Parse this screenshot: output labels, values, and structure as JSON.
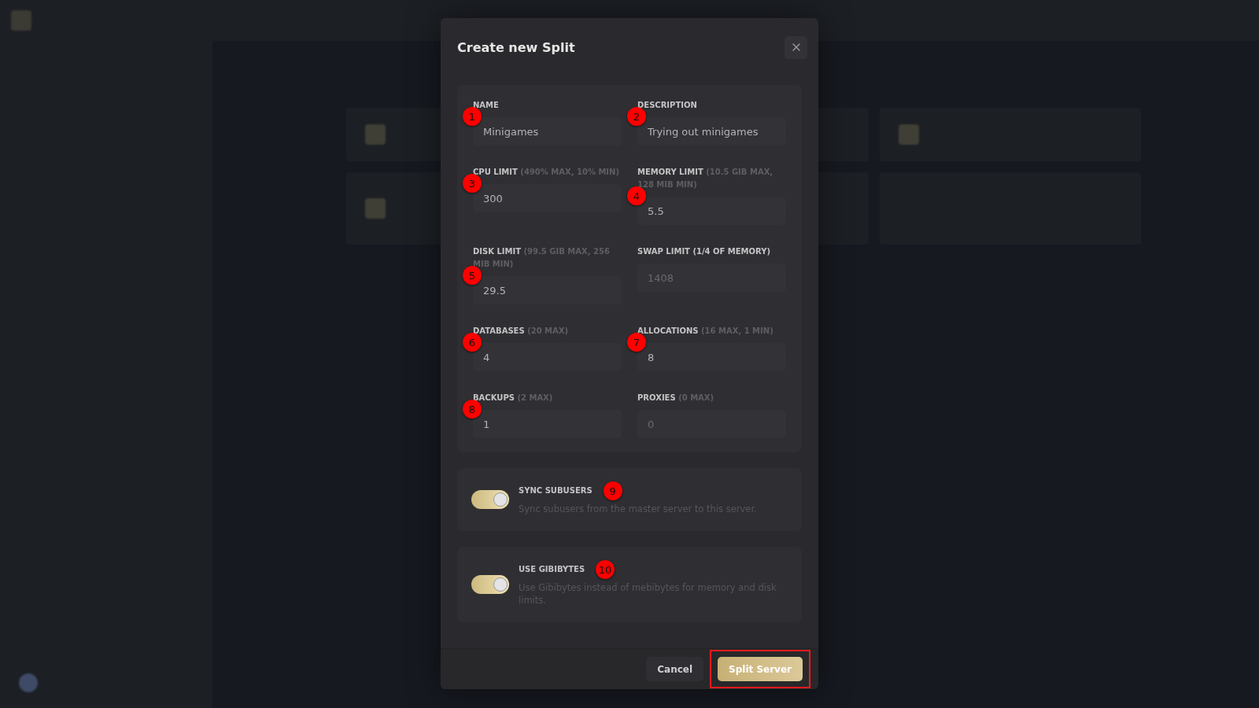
{
  "dialog": {
    "title": "Create new Split",
    "fields": [
      {
        "label": "NAME",
        "value": "Minigames",
        "disabled": false,
        "marker": "1"
      },
      {
        "label": "DESCRIPTION",
        "value": "Trying out minigames",
        "disabled": false,
        "marker": "2"
      },
      {
        "label": "CPU LIMIT",
        "hint": "(490% MAX, 10% MIN)",
        "value": "300",
        "disabled": false,
        "marker": "3"
      },
      {
        "label": "MEMORY LIMIT",
        "hint": "(10.5 GIB MAX, 128 MIB MIN)",
        "value": "5.5",
        "disabled": false,
        "marker": "4"
      },
      {
        "label": "DISK LIMIT",
        "hint": "(99.5 GIB MAX, 256 MIB MIN)",
        "value": "29.5",
        "disabled": false,
        "marker": "5"
      },
      {
        "label": "SWAP LIMIT (1/4 OF MEMORY)",
        "value": "1408",
        "disabled": true
      },
      {
        "label": "DATABASES",
        "hint": "(20 MAX)",
        "value": "4",
        "disabled": false,
        "marker": "6"
      },
      {
        "label": "ALLOCATIONS",
        "hint": "(16 MAX, 1 MIN)",
        "value": "8",
        "disabled": false,
        "marker": "7"
      },
      {
        "label": "BACKUPS",
        "hint": "(2 MAX)",
        "value": "1",
        "disabled": false,
        "marker": "8"
      },
      {
        "label": "PROXIES",
        "hint": "(0 MAX)",
        "value": "0",
        "disabled": true
      }
    ],
    "toggles": [
      {
        "label": "SYNC SUBUSERS",
        "description": "Sync subusers from the master server to this server.",
        "on": true,
        "marker": "9"
      },
      {
        "label": "USE GIBIBYTES",
        "description": "Use Gibibytes instead of mebibytes for memory and disk limits.",
        "on": true,
        "marker": "10"
      }
    ],
    "buttons": [
      {
        "label": "Cancel",
        "kind": "secondary",
        "highlighted": false
      },
      {
        "label": "Split Server",
        "kind": "primary",
        "highlighted": true
      }
    ]
  }
}
